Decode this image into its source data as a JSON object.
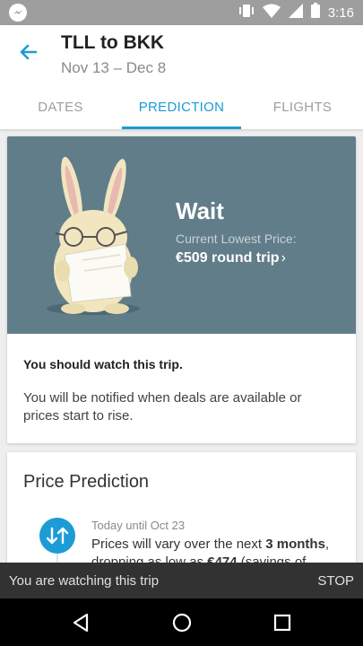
{
  "status_bar": {
    "time": "3:16",
    "icons": [
      "messenger-icon",
      "vibrate-icon",
      "wifi-icon",
      "signal-icon",
      "battery-icon"
    ]
  },
  "header": {
    "title": "TLL to BKK",
    "dates": "Nov 13 – Dec 8",
    "tabs": [
      {
        "label": "DATES",
        "active": false
      },
      {
        "label": "PREDICTION",
        "active": true
      },
      {
        "label": "FLIGHTS",
        "active": false
      }
    ]
  },
  "prediction_card": {
    "verdict": "Wait",
    "lowest_label": "Current Lowest Price:",
    "price": "€509 round trip",
    "watch_title": "You should watch this trip.",
    "watch_body": "You will be notified when deals are available or prices start to rise."
  },
  "price_prediction": {
    "title": "Price Prediction",
    "timeline": [
      {
        "date": "Today until Oct 23",
        "text_before": "Prices will vary over the next ",
        "text_bold": "3 months",
        "text_after": ", dropping as low as ",
        "text_bold2": "€474",
        "text_tail": " (savings of"
      }
    ]
  },
  "snackbar": {
    "text": "You are watching this trip",
    "action": "STOP"
  },
  "colors": {
    "accent": "#1d9bd6",
    "hero": "#617d89",
    "snackbar": "#323232"
  }
}
